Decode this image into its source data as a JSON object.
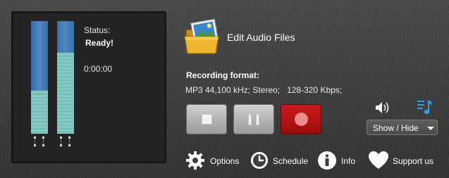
{
  "meter": {
    "status_label": "Status:",
    "status_value": "Ready!",
    "elapsed_time": "0:00:00",
    "channels": [
      {
        "name": "left",
        "level_percent": 38
      },
      {
        "name": "right",
        "level_percent": 72
      }
    ]
  },
  "edit_audio": {
    "label": "Edit Audio Files",
    "icon": "folder-photo-icon"
  },
  "recording": {
    "format_title": "Recording format:",
    "format_value": "MP3 44,100 kHz; Stereo;   128-320 Kbps;"
  },
  "controls": {
    "stop": {
      "icon": "stop-icon"
    },
    "pause": {
      "icon": "pause-icon"
    },
    "record": {
      "icon": "record-icon"
    }
  },
  "show_hide": {
    "label": "Show / Hide"
  },
  "links": {
    "options": {
      "label": "Options",
      "icon": "gear-icon"
    },
    "schedule": {
      "label": "Schedule",
      "icon": "clock-icon"
    },
    "info": {
      "label": "Info",
      "icon": "info-icon"
    },
    "support": {
      "label": "Support us",
      "icon": "heart-icon"
    }
  },
  "colors": {
    "meter_blue": "#4d88c4",
    "meter_cyan": "#a8e2dc",
    "record_red": "#c91b1b",
    "accent_blue": "#2aa0e8"
  }
}
